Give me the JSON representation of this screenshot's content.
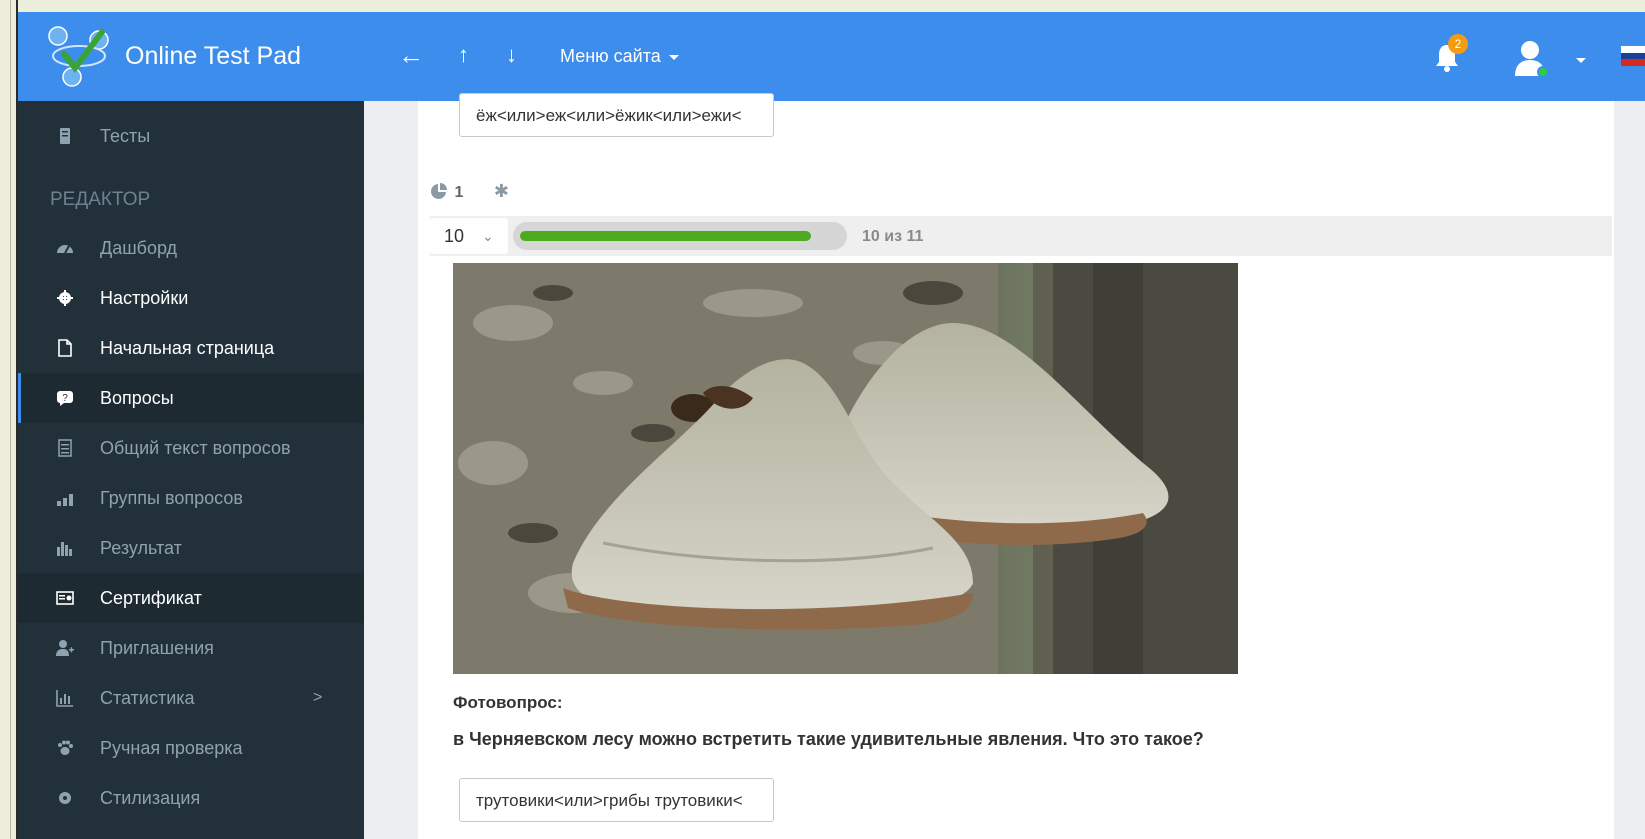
{
  "app": {
    "brand": "Online Test Pad"
  },
  "topbar": {
    "back_arrow": "←",
    "up_arrow": "↑",
    "down_arrow": "↓",
    "site_menu": "Меню сайта",
    "notification_count": "2"
  },
  "sidebar": {
    "items": [
      {
        "label": "Тесты",
        "icon": "document-icon"
      },
      {
        "label": "Дашборд",
        "icon": "dashboard-icon"
      },
      {
        "label": "Настройки",
        "icon": "gear-icon"
      },
      {
        "label": "Начальная страница",
        "icon": "page-icon"
      },
      {
        "label": "Вопросы",
        "icon": "question-icon"
      },
      {
        "label": "Общий текст вопросов",
        "icon": "list-icon"
      },
      {
        "label": "Группы вопросов",
        "icon": "groups-icon"
      },
      {
        "label": "Результат",
        "icon": "bar-chart-icon"
      },
      {
        "label": "Сертификат",
        "icon": "certificate-icon"
      },
      {
        "label": "Приглашения",
        "icon": "user-plus-icon"
      },
      {
        "label": "Статистика",
        "icon": "stats-icon"
      },
      {
        "label": "Ручная проверка",
        "icon": "paw-icon"
      },
      {
        "label": "Стилизация",
        "icon": "brush-icon"
      }
    ],
    "section_header": "РЕДАКТОР",
    "expand_chevron": ">"
  },
  "main": {
    "prev_answer": "ёж<или>еж<или>ёжик<или>ежи<",
    "meta": {
      "weight": "1",
      "required_mark": "✱"
    },
    "question_number": "10",
    "progress": {
      "text": "10 из 11",
      "fraction": 0.909
    },
    "question_type_label": "Фотовопрос:",
    "question_text": "в Черняевском лесу  можно встретить такие удивительные явления. Что это такое?",
    "answer": "трутовики<или>грибы трутовики<"
  },
  "colors": {
    "topbar": "#3c8dec",
    "sidebar": "#22303a",
    "progress": "#4caa1f",
    "badge": "#f39c12"
  }
}
